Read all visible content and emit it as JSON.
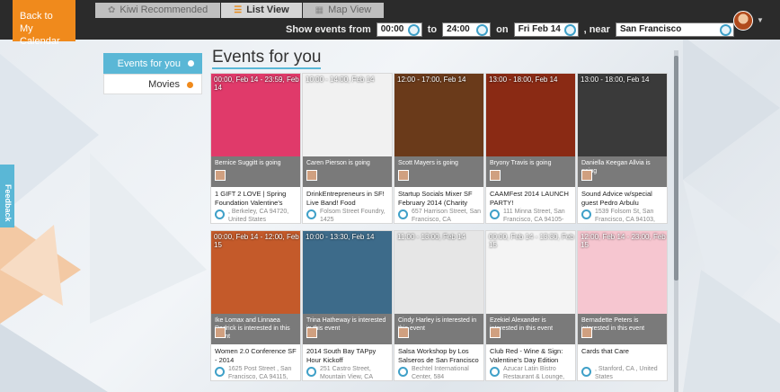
{
  "nav": {
    "back_label_line1": "Back to",
    "back_label_line2": "My Calendar",
    "tabs": [
      {
        "label": "Kiwi Recommended",
        "icon": "kiwi-icon"
      },
      {
        "label": "List View",
        "icon": "list-icon"
      },
      {
        "label": "Map View",
        "icon": "map-icon"
      }
    ]
  },
  "filters": {
    "prefix": "Show events from",
    "from_time": "00:00",
    "to_label": "to",
    "to_time": "24:00",
    "on_label": "on",
    "date": "Fri Feb 14",
    "near_label": ", near",
    "location": "San Francisco"
  },
  "sidebar": {
    "items": [
      {
        "label": "Events for you",
        "dot_color": "#ffffff"
      },
      {
        "label": "Movies",
        "dot_color": "#f08a1c"
      }
    ]
  },
  "feedback_label": "Feedback",
  "page_title": "Events for you",
  "cards": [
    {
      "time": "00:00, Feb 14 - 23:59, Feb 14",
      "going": "Bernice Suggitt is going",
      "title": "1 GIFT 2 LOVE | Spring Foundation Valentine's",
      "loc": ", Berkeley, CA 94720, United States",
      "bg": "#e03a6a"
    },
    {
      "time": "10:00 - 14:00, Feb 14",
      "going": "Caren Pierson is going",
      "title": "DrinkEntrepreneurs in SF! Live Band! Food",
      "loc": "Folsom Street Foundry, 1425",
      "bg": "#f1f1f1"
    },
    {
      "time": "12:00 - 17:00, Feb 14",
      "going": "Scott Mayers is going",
      "title": "Startup Socials Mixer SF February 2014 (Charity",
      "loc": "657 Harrison Street, San Francisco, CA",
      "bg": "#6a3a1a"
    },
    {
      "time": "13:00 - 18:00, Feb 14",
      "going": "Bryony Travis is going",
      "title": "CAAMFest 2014 LAUNCH PARTY!",
      "loc": "111 Minna Street, San Francisco, CA 94105-",
      "bg": "#8a2a14"
    },
    {
      "time": "13:00 - 18:00, Feb 14",
      "going": "Daniella Keegan Allvia is going",
      "title": "Sound Advice w/special guest Pedro Arbulu",
      "loc": "1539 Folsom St, San Francisco, CA 94103,",
      "bg": "#3a3a3a"
    },
    {
      "time": "00:00, Feb 14 - 12:00, Feb 15",
      "going": "Ike Lomax and Linnaea Dedrick is interested in this event",
      "title": "Women 2.0 Conference SF - 2014",
      "loc": "1625 Post Street , San Francisco, CA 94115,",
      "bg": "#c45a2a"
    },
    {
      "time": "10:00 - 13:30, Feb 14",
      "going": "Trina Hatheway is interested in this event",
      "title": "2014 South Bay TAPpy Hour Kickoff",
      "loc": "251 Castro Street, Mountain View, CA",
      "bg": "#3d6b8a"
    },
    {
      "time": "11:00 - 13:00, Feb 14",
      "going": "Cindy Harley is interested in this event",
      "title": "Salsa Workshop by Los Salseros de San Francisco",
      "loc": "Bechtel International Center, 584",
      "bg": "#e6e6e6"
    },
    {
      "time": "00:00, Feb 14 - 13:30, Feb 15",
      "going": "Ezekiel Alexander is interested in this event",
      "title": "Club Red - Wine & Sign: Valentine's Day Edition",
      "loc": "Azucar Latin Bistro Restaurant & Lounge,",
      "bg": "#f4f4f4"
    },
    {
      "time": "12:00, Feb 14 - 23:00, Feb 15",
      "going": "Bernadette Peters is interested in this event",
      "title": "Cards that Care",
      "loc": ", Stanford, CA , United States",
      "bg": "#f6c6d0"
    }
  ]
}
